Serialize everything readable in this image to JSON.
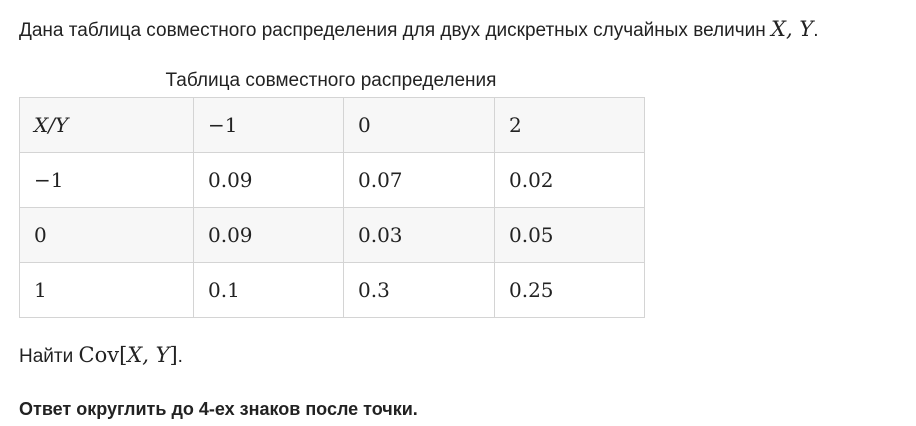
{
  "intro": {
    "text": "Дана таблица совместного распределения для двух дискретных случайных величин ",
    "math": "X, Y",
    "end": "."
  },
  "table": {
    "caption": "Таблица совместного распределения",
    "header": [
      "X/Y",
      "−1",
      "0",
      "2"
    ],
    "rows": [
      [
        "−1",
        "0.09",
        "0.07",
        "0.02"
      ],
      [
        "0",
        "0.09",
        "0.03",
        "0.05"
      ],
      [
        "1",
        "0.1",
        "0.3",
        "0.25"
      ]
    ]
  },
  "question": {
    "text": "Найти ",
    "func": "Cov",
    "open": "[",
    "args": "X, Y",
    "close": "]",
    "end": "."
  },
  "note": "Ответ округлить до 4-ех знаков после точки."
}
